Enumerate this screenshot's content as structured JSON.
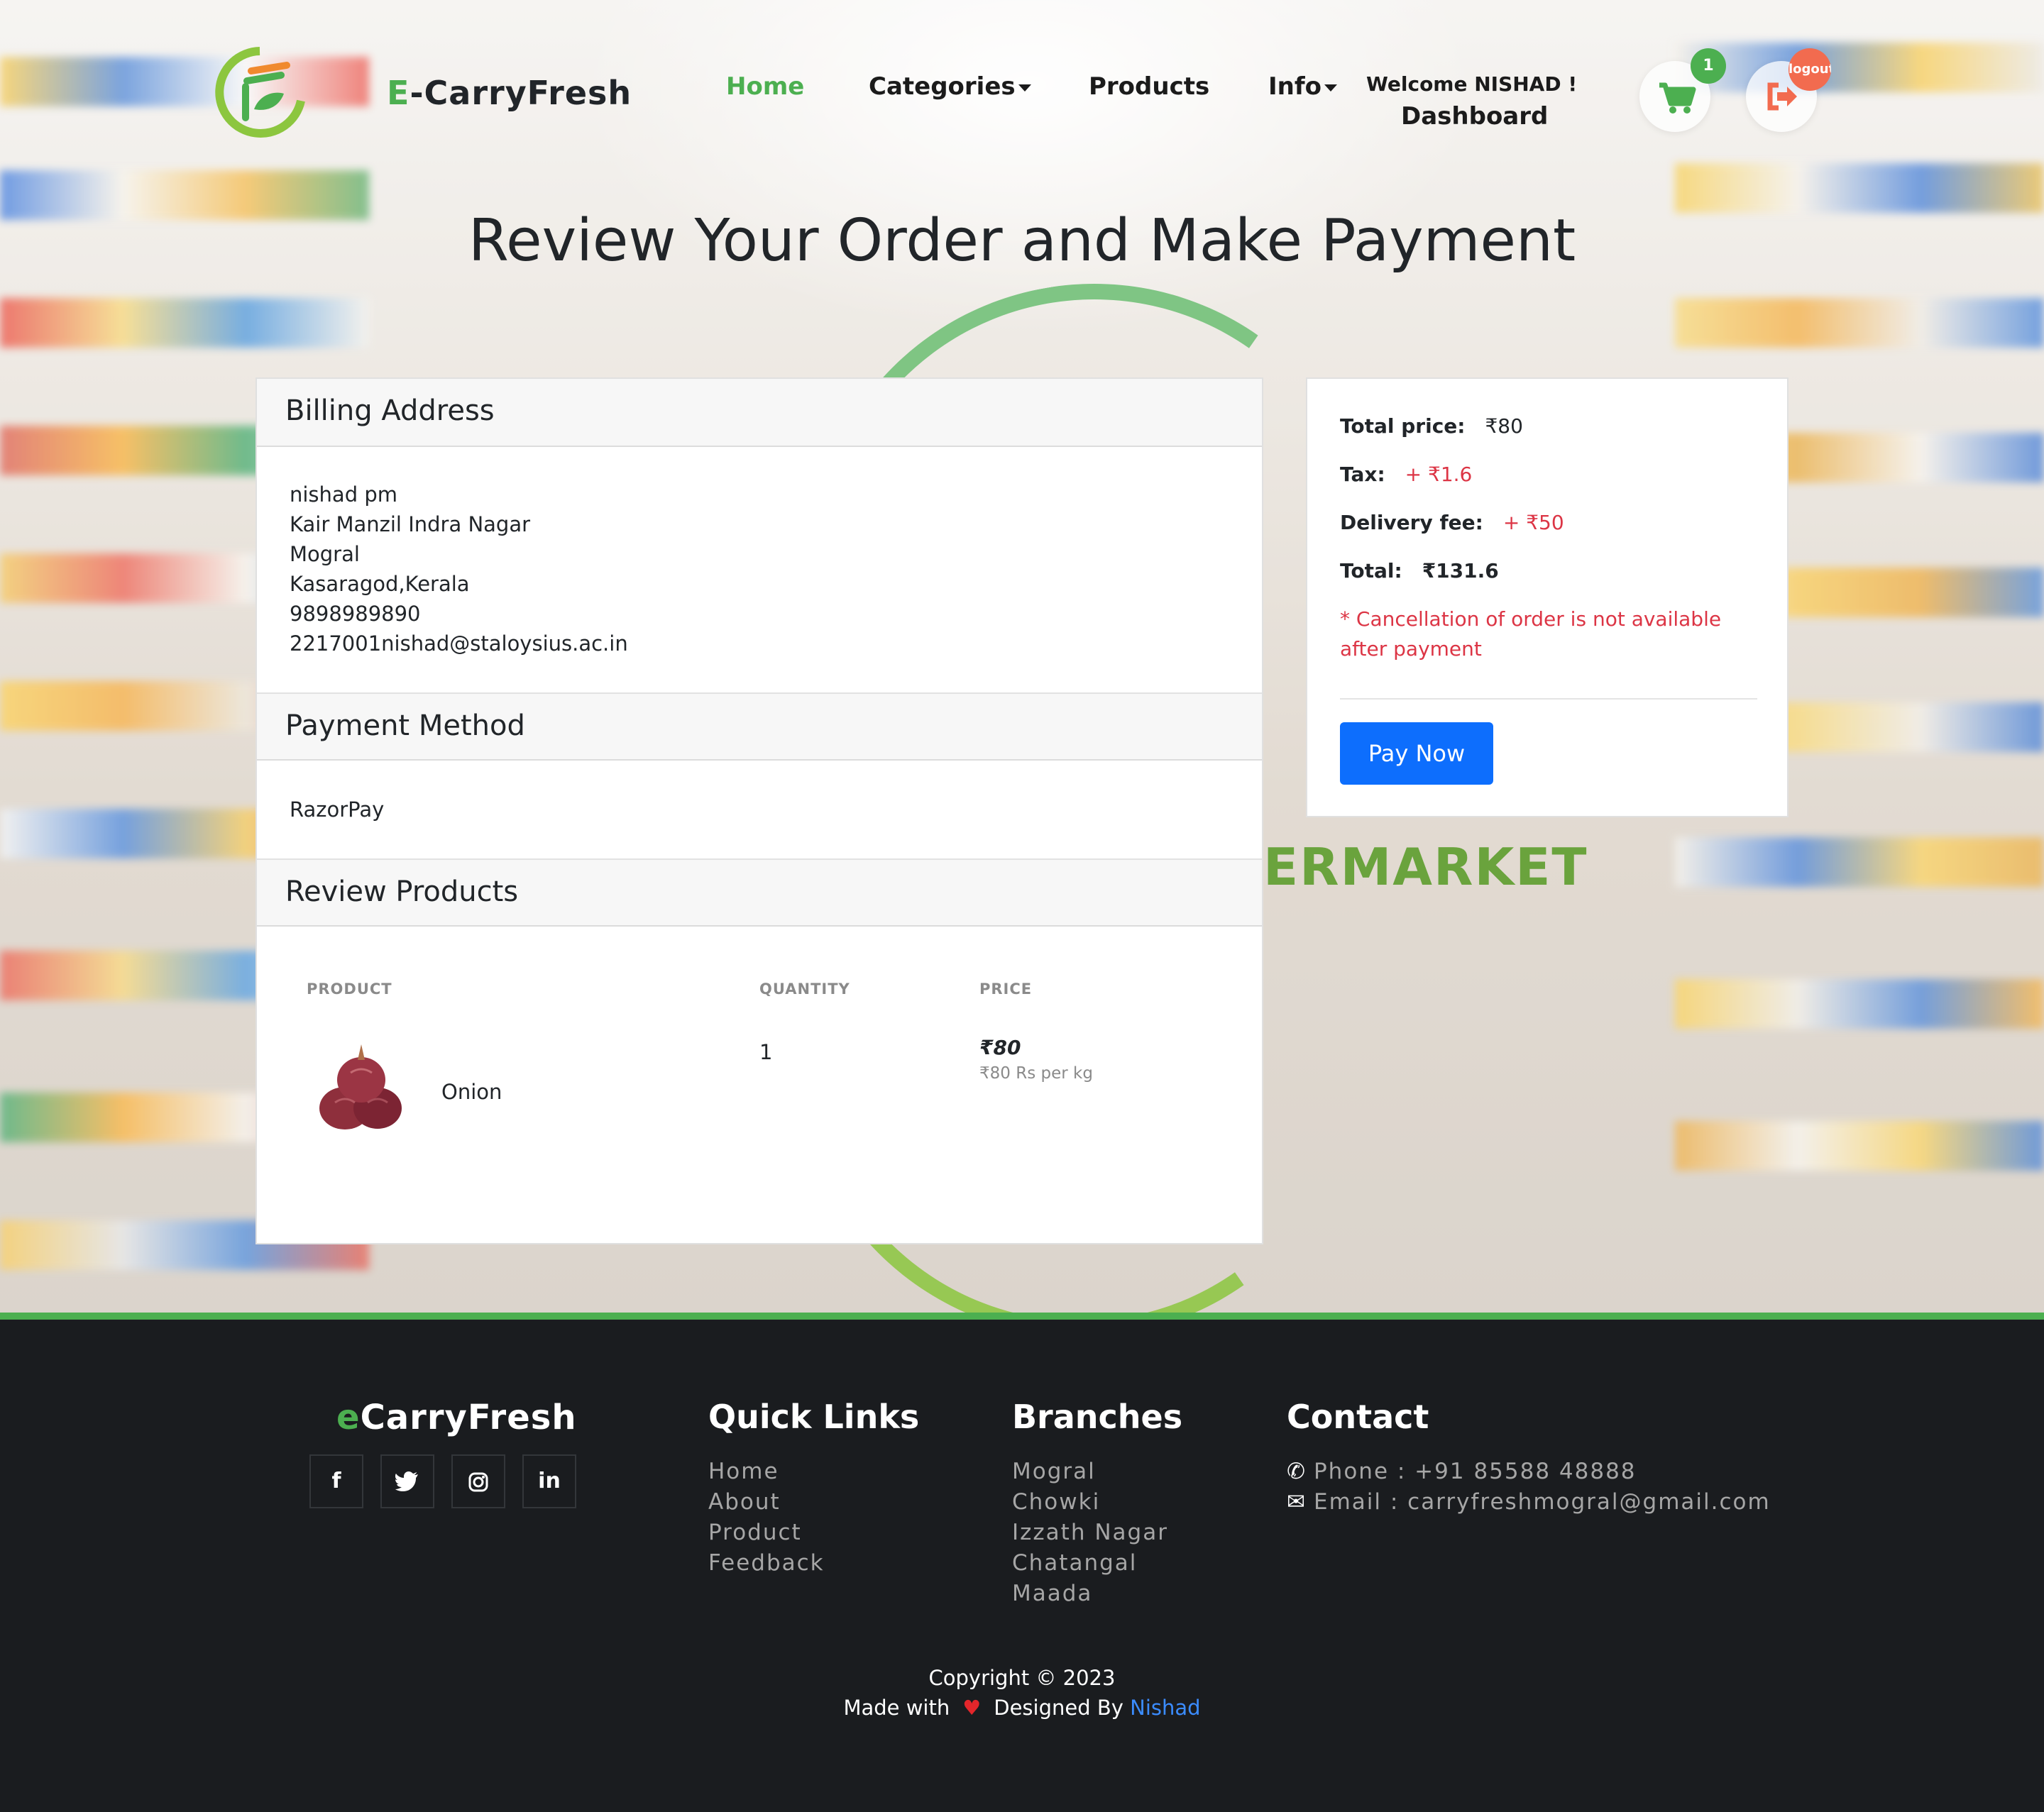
{
  "brand": {
    "initial": "E",
    "rest": "-CarryFresh"
  },
  "nav": {
    "home": "Home",
    "categories": "Categories",
    "products": "Products",
    "info": "Info",
    "welcome": "Welcome NISHAD !",
    "dashboard": "Dashboard",
    "cart_count": "1",
    "logout": "logout"
  },
  "page_title": "Review Your Order and Make Payment",
  "billing": {
    "heading": "Billing Address",
    "lines": [
      "nishad pm",
      "Kair Manzil Indra Nagar",
      "Mogral",
      "Kasaragod,Kerala",
      "9898989890",
      "2217001nishad@staloysius.ac.in"
    ]
  },
  "payment": {
    "heading": "Payment Method",
    "method": "RazorPay"
  },
  "review": {
    "heading": "Review Products",
    "columns": [
      "PRODUCT",
      "QUANTITY",
      "PRICE"
    ],
    "items": [
      {
        "name": "Onion",
        "quantity": "1",
        "price": "₹80",
        "unit_price": "₹80 Rs per kg"
      }
    ]
  },
  "summary": {
    "total_price_label": "Total price:",
    "total_price": "₹80",
    "tax_label": "Tax:",
    "tax": "+ ₹1.6",
    "delivery_label": "Delivery fee:",
    "delivery": "+ ₹50",
    "total_label": "Total:",
    "total": "₹131.6",
    "note": "* Cancellation of order is not available after payment",
    "pay_button": "Pay Now"
  },
  "footer": {
    "brand_initial": "e",
    "brand_rest": "CarryFresh",
    "social_icons": [
      "facebook-icon",
      "twitter-icon",
      "instagram-icon",
      "linkedin-icon"
    ],
    "quick_links_heading": "Quick Links",
    "quick_links": [
      "Home",
      "About",
      "Product",
      "Feedback"
    ],
    "branches_heading": "Branches",
    "branches": [
      "Mogral",
      "Chowki",
      "Izzath Nagar",
      "Chatangal",
      "Maada"
    ],
    "contact_heading": "Contact",
    "phone": "Phone : +91 85588 48888",
    "email": "Email : carryfreshmogral@gmail.com",
    "copyright": "Copyright © 2023",
    "made_with": "Made with",
    "designed_by": "Designed By",
    "author": "Nishad"
  },
  "colors": {
    "accent": "#4caf50",
    "pay_button": "#0d6efd",
    "warning_text": "#dc3545",
    "logout_badge": "#f26b4f",
    "footer_bg": "#1a1c1f"
  }
}
